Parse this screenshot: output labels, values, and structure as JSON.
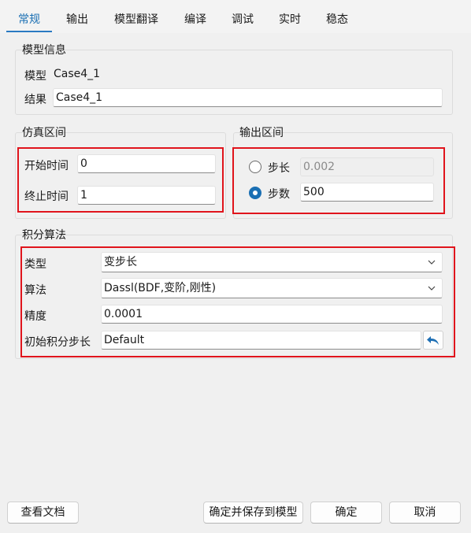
{
  "tabs": [
    {
      "label": "常规",
      "active": true
    },
    {
      "label": "输出"
    },
    {
      "label": "模型翻译"
    },
    {
      "label": "编译"
    },
    {
      "label": "调试"
    },
    {
      "label": "实时"
    },
    {
      "label": "稳态"
    }
  ],
  "model_info": {
    "title": "模型信息",
    "model_label": "模型",
    "model_value": "Case4_1",
    "result_label": "结果",
    "result_value": "Case4_1"
  },
  "sim_interval": {
    "title": "仿真区间",
    "start_label": "开始时间",
    "start_value": "0",
    "stop_label": "终止时间",
    "stop_value": "1"
  },
  "output_interval": {
    "title": "输出区间",
    "step_size_label": "步长",
    "step_size_value": "0.002",
    "step_size_selected": false,
    "step_count_label": "步数",
    "step_count_value": "500",
    "step_count_selected": true
  },
  "integration": {
    "title": "积分算法",
    "type_label": "类型",
    "type_value": "变步长",
    "algorithm_label": "算法",
    "algorithm_value": "Dassl(BDF,变阶,刚性)",
    "precision_label": "精度",
    "precision_value": "0.0001",
    "initial_step_label": "初始积分步长",
    "initial_step_value": "Default"
  },
  "buttons": {
    "view_docs": "查看文档",
    "confirm_save": "确定并保存到模型",
    "ok": "确定",
    "cancel": "取消"
  },
  "colors": {
    "accent": "#1a6fb3",
    "highlight_box": "#e0141c"
  },
  "icons": {
    "reset": "undo-arrow-icon",
    "dropdown": "chevron-down-icon"
  }
}
